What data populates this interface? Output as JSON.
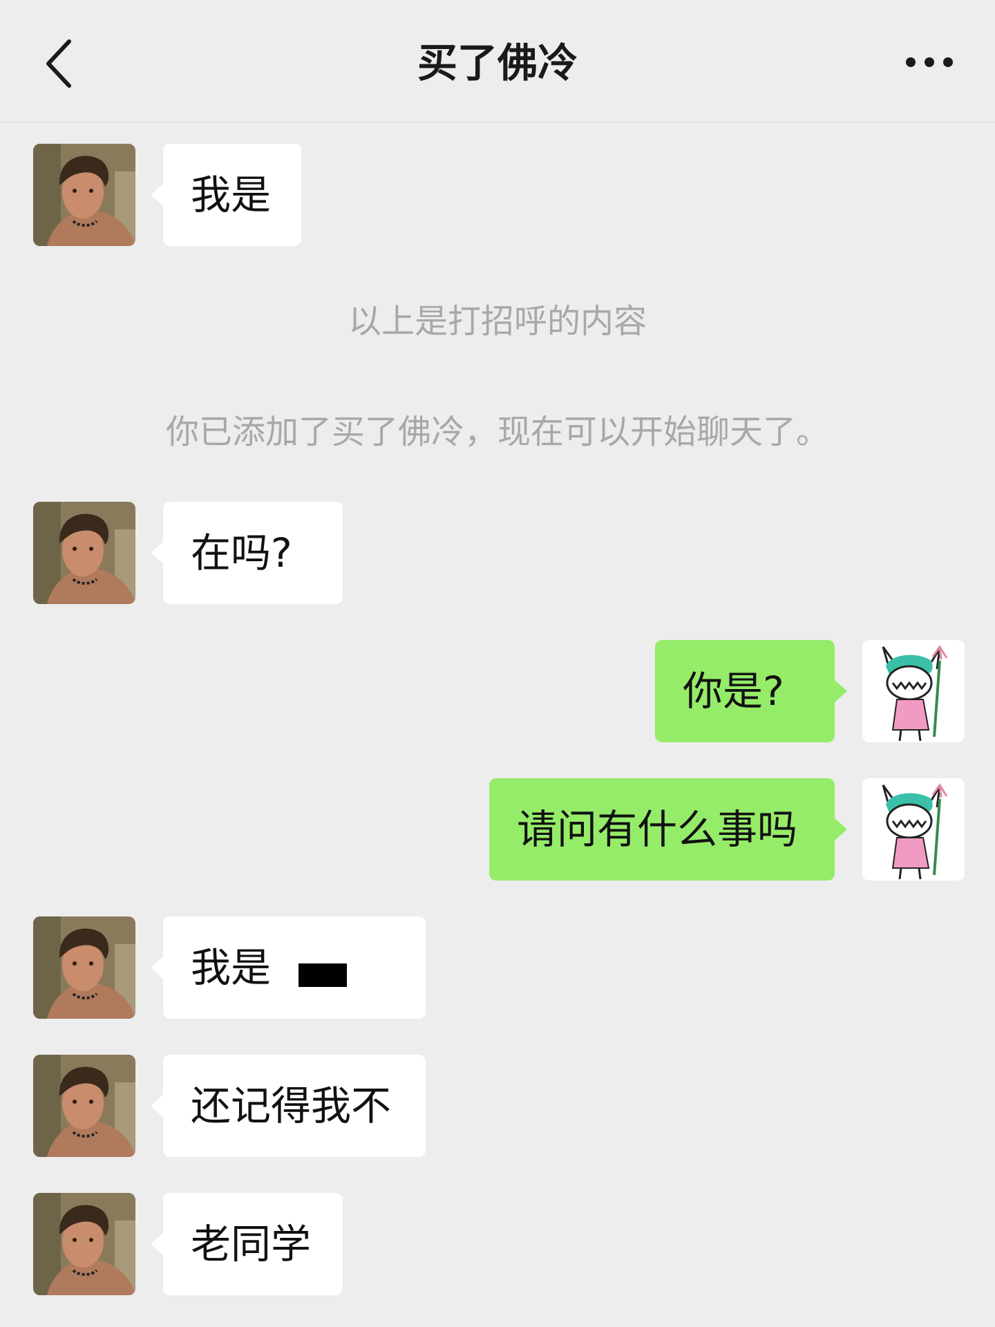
{
  "header": {
    "title": "买了佛冷",
    "back_icon": "chevron-left-icon",
    "more_icon": "more-dots-icon"
  },
  "messages": [
    {
      "from": "contact",
      "text": "我是"
    },
    {
      "from": "system",
      "text": "以上是打招呼的内容"
    },
    {
      "from": "system",
      "text": "你已添加了买了佛冷，现在可以开始聊天了。"
    },
    {
      "from": "contact",
      "text": "在吗?"
    },
    {
      "from": "self",
      "text": "你是?"
    },
    {
      "from": "self",
      "text": "请问有什么事吗"
    },
    {
      "from": "contact",
      "text": "我是"
    },
    {
      "from": "contact",
      "text": "还记得我不"
    },
    {
      "from": "contact",
      "text": "老同学"
    }
  ],
  "colors": {
    "background": "#ededed",
    "incoming_bubble": "#ffffff",
    "outgoing_bubble": "#95ec69",
    "system_text": "#a8a8a8"
  }
}
